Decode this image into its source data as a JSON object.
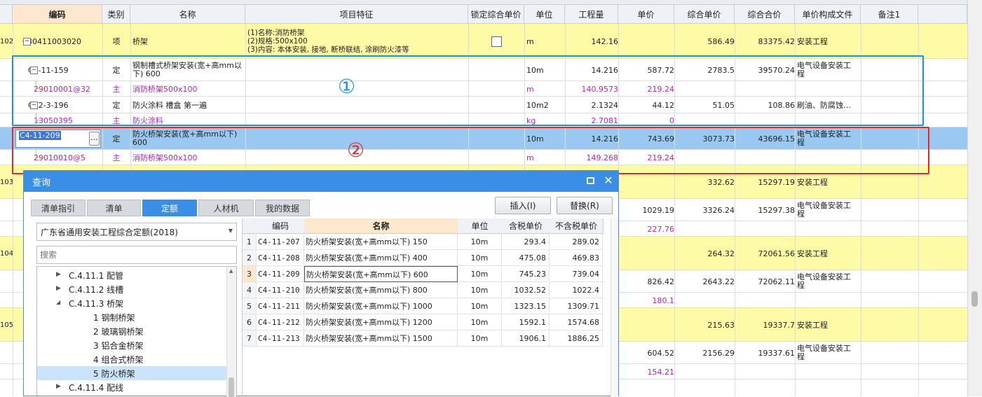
{
  "headers": [
    "编码",
    "类别",
    "名称",
    "项目特征",
    "锁定综合单价",
    "单位",
    "工程量",
    "单价",
    "综合单价",
    "综合合价",
    "单价构成文件",
    "备注1"
  ],
  "rows": [
    {
      "rownum": "102",
      "code": "030411003020",
      "type": "项",
      "name": "桥架",
      "feature": [
        "(1)名称:消防桥架",
        "(2)规格:500x100",
        "(3)内容: 本体安装, 接地, 断桥联结, 涂刷防火漆等"
      ],
      "unit": "m",
      "qty": "142.16",
      "price": "",
      "uprice": "586.49",
      "total": "83375.42",
      "file": "安装工程",
      "style": "yellow"
    },
    {
      "code": "C4-11-159",
      "type": "定",
      "name": [
        "钢制槽式桥架安装(宽+高mm以",
        "下) 600"
      ],
      "unit": "10m",
      "qty": "14.216",
      "price": "587.72",
      "uprice": "2783.5",
      "total": "39570.24",
      "file": [
        "电气设备安装工",
        "程"
      ],
      "style": "white"
    },
    {
      "code": "29010001@32",
      "type": "主",
      "name": "消防桥架500x100",
      "unit": "m",
      "qty": "140.9573",
      "price": "219.24",
      "style": "white",
      "purple": true
    },
    {
      "code": "C12-3-196",
      "type": "定",
      "name": "防火涂料 槽盒 第一遍",
      "unit": "10m2",
      "qty": "2.1324",
      "price": "44.12",
      "uprice": "51.05",
      "total": "108.86",
      "file": "刷油、防腐蚀…",
      "style": "white"
    },
    {
      "code": "13050395",
      "type": "主",
      "name": "防火涂料",
      "unit": "kg",
      "qty": "2.7081",
      "price": "0",
      "style": "white",
      "purple": true
    },
    {
      "code": "C4-11-209",
      "type": "定",
      "name": [
        "防火桥架安装(宽+高mm以下)",
        "600"
      ],
      "unit": "10m",
      "qty": "14.216",
      "price": "743.69",
      "uprice": "3073.73",
      "total": "43696.15",
      "file": [
        "电气设备安装工",
        "程"
      ],
      "style": "sel"
    },
    {
      "code": "29010010@5",
      "type": "主",
      "name": "消防桥架500x100",
      "unit": "m",
      "qty": "149.268",
      "price": "219.24",
      "style": "white",
      "purple": true
    },
    {
      "rownum": "103",
      "uprice": "332.62",
      "total": "15297.19",
      "file": "安装工程",
      "style": "yellow"
    },
    {
      "price": "1029.19",
      "uprice": "3326.24",
      "total": "15297.38",
      "file": [
        "电气设备安装工",
        "程"
      ],
      "style": "white"
    },
    {
      "price": "227.76",
      "style": "white",
      "purple": true
    },
    {
      "rownum": "104",
      "uprice": "264.32",
      "total": "72061.56",
      "file": "安装工程",
      "style": "yellow"
    },
    {
      "price": "826.42",
      "uprice": "2643.22",
      "total": "72062.11",
      "file": [
        "电气设备安装工",
        "程"
      ],
      "style": "white"
    },
    {
      "price": "180.1",
      "style": "white",
      "purple": true
    },
    {
      "rownum": "105",
      "uprice": "215.63",
      "total": "19337.7",
      "file": "安装工程",
      "style": "yellow"
    },
    {
      "price": "604.52",
      "uprice": "2156.29",
      "total": "19337.61",
      "file": [
        "电气设备安装工",
        "程"
      ],
      "style": "white"
    },
    {
      "price": "154.21",
      "style": "white",
      "purple": true
    }
  ],
  "annotations": {
    "one": "①",
    "two": "②",
    "color_one": "#1e90e0",
    "color_two": "#e02a2a"
  },
  "dialog": {
    "title": "查询",
    "tabs": [
      "清单指引",
      "清单",
      "定额",
      "人材机",
      "我的数据"
    ],
    "active_tab": "定额",
    "insert_button": "插入(I)",
    "replace_button": "替换(R)",
    "library": "广东省通用安装工程综合定额(2018)",
    "search_placeholder": "搜索",
    "tree": [
      {
        "label": "C.4.11.1 配管",
        "level": 1,
        "arrow": "right"
      },
      {
        "label": "C.4.11.2 线槽",
        "level": 1,
        "arrow": "right"
      },
      {
        "label": "C.4.11.3 桥架",
        "level": 1,
        "arrow": "down"
      },
      {
        "label": "1 钢制桥架",
        "level": 2
      },
      {
        "label": "2 玻璃钢桥架",
        "level": 2
      },
      {
        "label": "3 铝合金桥架",
        "level": 2
      },
      {
        "label": "4 组合式桥架",
        "level": 2
      },
      {
        "label": "5 防火桥架",
        "level": 2,
        "selected": true
      },
      {
        "label": "C.4.11.4 配线",
        "level": 1,
        "arrow": "right"
      }
    ],
    "table_headers": [
      "编码",
      "名称",
      "单位",
      "含税单价",
      "不含税单价"
    ],
    "table_rows": [
      {
        "n": "1",
        "code": "C4-11-207",
        "name": "防火桥架安装(宽+高mm以下) 150",
        "unit": "10m",
        "tax": "293.4",
        "notax": "289.02"
      },
      {
        "n": "2",
        "code": "C4-11-208",
        "name": "防火桥架安装(宽+高mm以下) 400",
        "unit": "10m",
        "tax": "475.08",
        "notax": "469.83"
      },
      {
        "n": "3",
        "code": "C4-11-209",
        "name": "防火桥架安装(宽+高mm以下) 600",
        "unit": "10m",
        "tax": "745.23",
        "notax": "739.04",
        "selected": true
      },
      {
        "n": "4",
        "code": "C4-11-210",
        "name": "防火桥架安装(宽+高mm以下) 800",
        "unit": "10m",
        "tax": "1032.52",
        "notax": "1022.4"
      },
      {
        "n": "5",
        "code": "C4-11-211",
        "name": "防火桥架安装(宽+高mm以下) 1000",
        "unit": "10m",
        "tax": "1323.15",
        "notax": "1309.71"
      },
      {
        "n": "6",
        "code": "C4-11-212",
        "name": "防火桥架安装(宽+高mm以下) 1200",
        "unit": "10m",
        "tax": "1592.1",
        "notax": "1574.68"
      },
      {
        "n": "7",
        "code": "C4-11-213",
        "name": "防火桥架安装(宽+高mm以下) 1500",
        "unit": "10m",
        "tax": "1906.1",
        "notax": "1886.25"
      }
    ]
  }
}
